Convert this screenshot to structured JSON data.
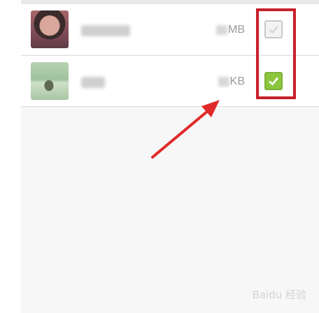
{
  "files": [
    {
      "name": "",
      "size": "MB",
      "checked": false,
      "thumbnail": "portrait-photo"
    },
    {
      "name": "",
      "size": "KB",
      "checked": true,
      "thumbnail": "landscape-photo"
    }
  ],
  "annotation": {
    "box_color": "#c8202c",
    "arrow_color": "#e02a2a"
  },
  "colors": {
    "check_on": "#8cc63f",
    "check_off_border": "#c9c9c9"
  },
  "watermark": {
    "text": "Baidu 经验"
  }
}
